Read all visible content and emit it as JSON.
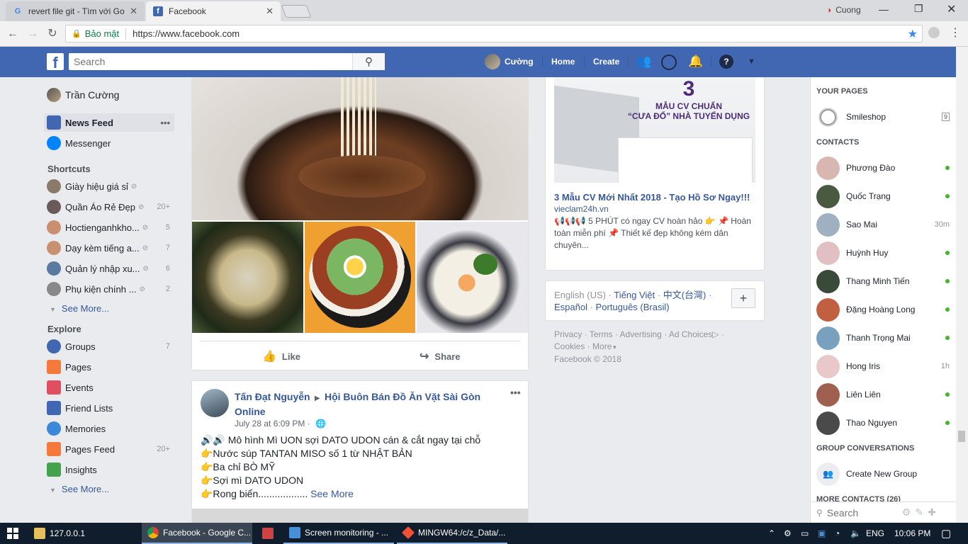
{
  "browser": {
    "tabs": [
      {
        "label": "revert file git - Tìm với Go",
        "icon": "google-icon"
      },
      {
        "label": "Facebook",
        "icon": "facebook-icon"
      }
    ],
    "profile": "Cuong",
    "secure_label": "Bảo mật",
    "url": "https://www.facebook.com"
  },
  "header": {
    "search_placeholder": "Search",
    "user": "Cường",
    "home": "Home",
    "create": "Create"
  },
  "left": {
    "profile_name": "Trần Cường",
    "news_feed": "News Feed",
    "messenger": "Messenger",
    "shortcuts_title": "Shortcuts",
    "shortcuts": [
      {
        "label": "Giày hiệu giá sỉ",
        "count": ""
      },
      {
        "label": "Quần Áo Rẻ Đẹp",
        "count": "20+"
      },
      {
        "label": "Hoctienganhkho...",
        "count": "5"
      },
      {
        "label": "Dạy kèm tiếng a...",
        "count": "7"
      },
      {
        "label": "Quản lý nhập xu...",
        "count": "6"
      },
      {
        "label": "Phụ kiện chính ...",
        "count": "2"
      }
    ],
    "see_more": "See More...",
    "explore_title": "Explore",
    "explore": [
      {
        "label": "Groups",
        "count": "7",
        "color": "#4267b2"
      },
      {
        "label": "Pages",
        "count": "",
        "color": "#f5793a"
      },
      {
        "label": "Events",
        "count": "",
        "color": "#e04f5f"
      },
      {
        "label": "Friend Lists",
        "count": "",
        "color": "#4267b2"
      },
      {
        "label": "Memories",
        "count": "",
        "color": "#3b87d9"
      },
      {
        "label": "Pages Feed",
        "count": "20+",
        "color": "#f5793a"
      },
      {
        "label": "Insights",
        "count": "",
        "color": "#44a24c"
      }
    ],
    "see_more2": "See More..."
  },
  "feed": {
    "like": "Like",
    "share": "Share",
    "post": {
      "author": "Tấn Đạt Nguyễn",
      "group": "Hội Buôn Bán Đồ Ăn Vặt Sài Gòn Online",
      "time": "July 28 at 6:09 PM ·",
      "lines": [
        "🔊🔊 Mô hình Mì UON sợi DATO UDON cán & cắt ngay tại chỗ",
        "👉Nước súp TANTAN MISO số 1 từ NHẬT BẢN",
        "👉Ba chỉ BÒ MỸ",
        "👉Sợi mì DATO UDON",
        "👉Rong biển.................."
      ],
      "see_more": "See More"
    }
  },
  "ad": {
    "image_big": "3",
    "image_line1": "MẪU CV CHUẨN",
    "image_line2": "“CƯA ĐỔ” NHÀ TUYỂN DỤNG",
    "title": "3 Mẫu CV Mới Nhất 2018 - Tạo Hồ Sơ Ngay!!!",
    "domain": "vieclam24h.vn",
    "body": "📢📢📢 5 PHÚT có ngay CV hoàn hảo 👉 📌 Hoàn toàn miễn phí 📌 Thiết kế đẹp không kém dân chuyên..."
  },
  "lang": {
    "current": "English (US)",
    "options": [
      "Tiếng Việt",
      "中文(台灣)",
      "Español",
      "Português (Brasil)"
    ]
  },
  "footer": {
    "links": [
      "Privacy",
      "Terms",
      "Advertising",
      "Ad Choices",
      "Cookies",
      "More"
    ],
    "copyright": "Facebook © 2018"
  },
  "right": {
    "your_pages": "YOUR PAGES",
    "page": "Smileshop",
    "page_count": "9",
    "contacts_title": "CONTACTS",
    "contacts": [
      {
        "name": "Phương Đào",
        "status": "online"
      },
      {
        "name": "Quốc Trạng",
        "status": "online"
      },
      {
        "name": "Sao Mai",
        "status": "30m"
      },
      {
        "name": "Huỳnh Huy",
        "status": "online"
      },
      {
        "name": "Thang Minh Tiến",
        "status": "online"
      },
      {
        "name": "Đặng Hoàng Long",
        "status": "online"
      },
      {
        "name": "Thanh Trọng Mai",
        "status": "online"
      },
      {
        "name": "Hong Iris",
        "status": "1h"
      },
      {
        "name": "Liên Liên",
        "status": "online"
      },
      {
        "name": "Thao Nguyen",
        "status": "online"
      }
    ],
    "group_conv": "GROUP CONVERSATIONS",
    "create_group": "Create New Group",
    "more_contacts": "MORE CONTACTS (26)",
    "search_placeholder": "Search"
  },
  "taskbar": {
    "items": [
      "127.0.0.1",
      "Facebook - Google C...",
      "",
      "Screen monitoring - ...",
      "MINGW64:/c/z_Data/..."
    ],
    "lang": "ENG",
    "time": "10:06 PM"
  }
}
